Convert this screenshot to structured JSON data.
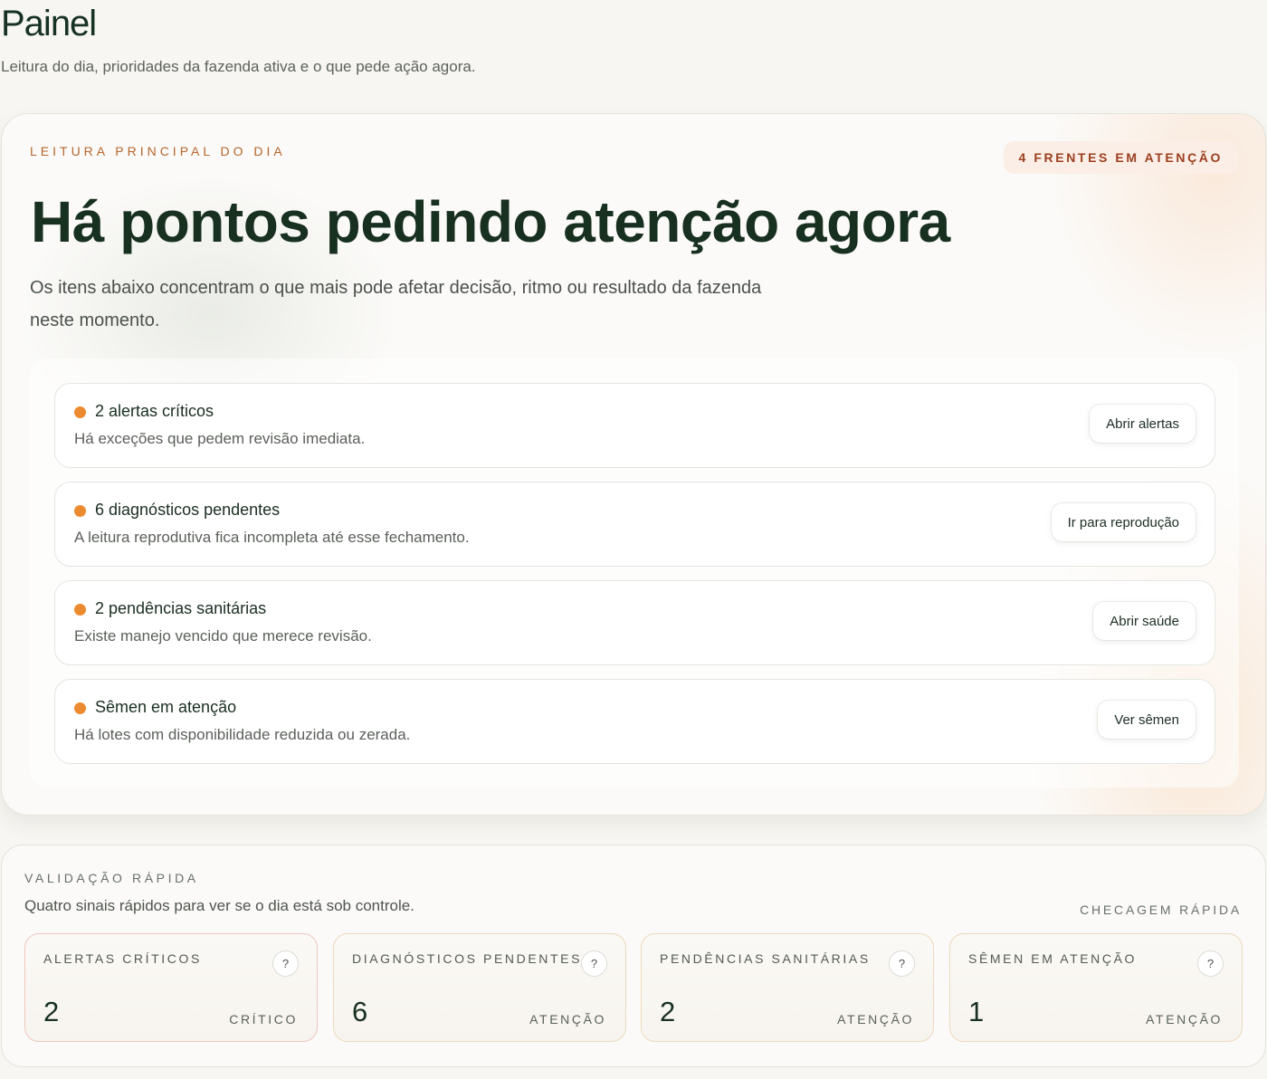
{
  "header": {
    "title": "Painel",
    "subtitle": "Leitura do dia, prioridades da fazenda ativa e o que pede ação agora."
  },
  "hero": {
    "eyebrow": "LEITURA PRINCIPAL DO DIA",
    "badge": "4 FRENTES EM ATENÇÃO",
    "title": "Há pontos pedindo atenção agora",
    "description": "Os itens abaixo concentram o que mais pode afetar decisão, ritmo ou resultado da fazenda neste momento.",
    "items": [
      {
        "title": "2 alertas críticos",
        "description": "Há exceções que pedem revisão imediata.",
        "action": "Abrir alertas"
      },
      {
        "title": "6 diagnósticos pendentes",
        "description": "A leitura reprodutiva fica incompleta até esse fechamento.",
        "action": "Ir para reprodução"
      },
      {
        "title": "2 pendências sanitárias",
        "description": "Existe manejo vencido que merece revisão.",
        "action": "Abrir saúde"
      },
      {
        "title": "Sêmen em atenção",
        "description": "Há lotes com disponibilidade reduzida ou zerada.",
        "action": "Ver sêmen"
      }
    ]
  },
  "validation": {
    "eyebrow": "VALIDAÇÃO RÁPIDA",
    "description": "Quatro sinais rápidos para ver se o dia está sob controle.",
    "tag": "CHECAGEM RÁPIDA",
    "metrics": [
      {
        "label": "ALERTAS CRÍTICOS",
        "value": "2",
        "status": "CRÍTICO",
        "help": "?"
      },
      {
        "label": "DIAGNÓSTICOS PENDENTES",
        "value": "6",
        "status": "ATENÇÃO",
        "help": "?"
      },
      {
        "label": "PENDÊNCIAS SANITÁRIAS",
        "value": "2",
        "status": "ATENÇÃO",
        "help": "?"
      },
      {
        "label": "SÊMEN EM ATENÇÃO",
        "value": "1",
        "status": "ATENÇÃO",
        "help": "?"
      }
    ]
  },
  "colors": {
    "accent_orange": "#ec8a30",
    "critical_border": "#f0c6bd",
    "attention_border": "#eed9be",
    "title_green": "#18301f"
  },
  "icons": {
    "status_dot": "status-dot-icon",
    "help": "help-icon"
  }
}
